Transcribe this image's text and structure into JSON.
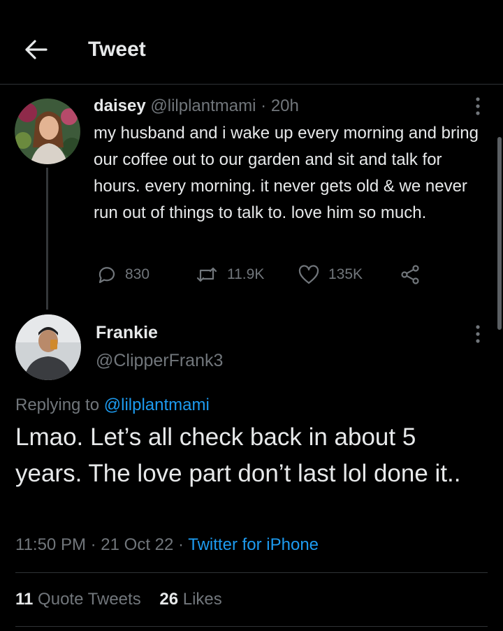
{
  "header": {
    "title": "Tweet",
    "back_icon": "arrow-left-icon"
  },
  "original_tweet": {
    "display_name": "daisey",
    "handle": "@lilplantmami",
    "separator": "·",
    "time": "20h",
    "text": "my husband and i wake up every morning and bring our coffee out to our garden and sit and talk for hours. every morning. it never gets old & we never run out of things to talk to. love him so much.",
    "actions": {
      "replies": "830",
      "retweets": "11.9K",
      "likes": "135K"
    }
  },
  "reply_tweet": {
    "display_name": "Frankie",
    "handle": "@ClipperFrank3",
    "replying_prefix": "Replying to",
    "replying_to": "@lilplantmami",
    "text": "Lmao. Let’s all check back in about 5 years. The love part don’t last lol done it..",
    "time": "11:50 PM",
    "date": "21 Oct 22",
    "separator": "·",
    "source": "Twitter for iPhone",
    "stats": {
      "quote_count": "11",
      "quote_label": "Quote Tweets",
      "like_count": "26",
      "like_label": "Likes"
    }
  },
  "colors": {
    "background": "#000000",
    "text": "#e7e9ea",
    "secondary": "#71767b",
    "accent": "#1d9bf0",
    "divider": "#2f3336"
  }
}
